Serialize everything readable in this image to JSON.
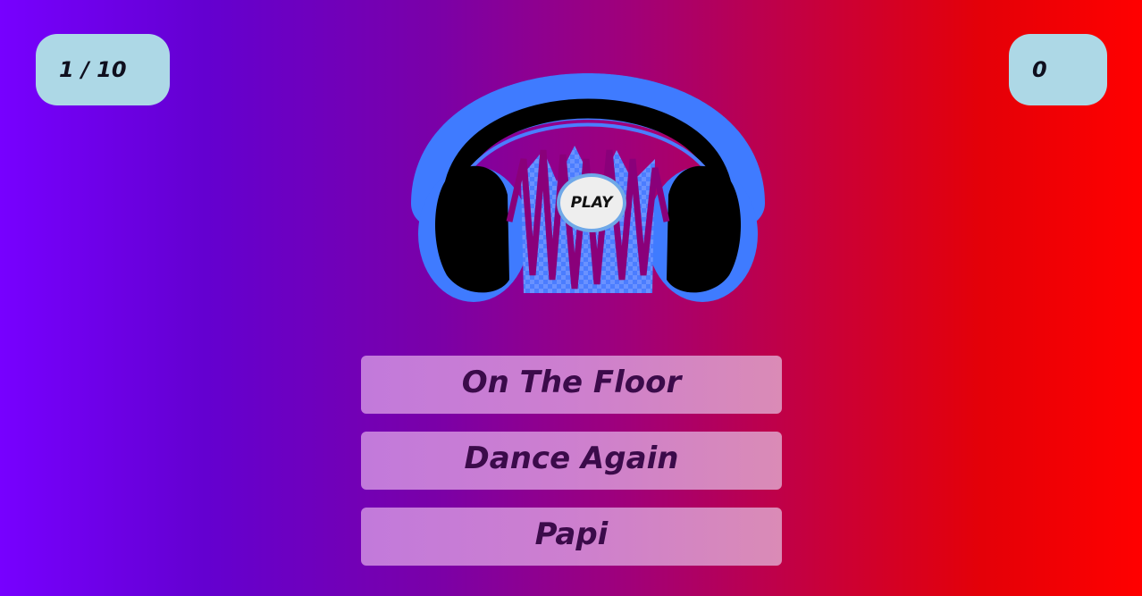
{
  "round_counter": "1 / 10",
  "score": "0",
  "player": {
    "icon": "headphones-icon",
    "play_label": "PLAY"
  },
  "answers": [
    {
      "label": "On The Floor"
    },
    {
      "label": "Dance Again"
    },
    {
      "label": "Papi"
    }
  ],
  "colors": {
    "gradient_start": "#7700ff",
    "gradient_end": "#ff0000",
    "badge": "#add8e6",
    "answer_text": "#3b0b4a",
    "headphone_glow": "#3f7bff"
  }
}
